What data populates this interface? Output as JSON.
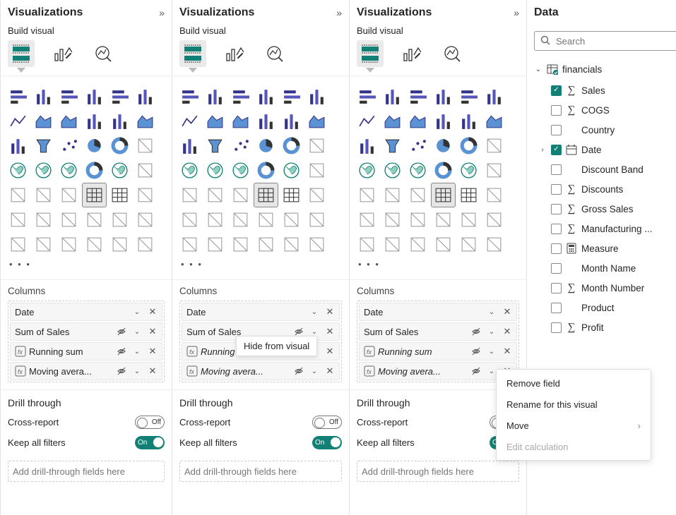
{
  "pane": {
    "vis_title": "Visualizations",
    "build_label": "Build visual",
    "data_title": "Data"
  },
  "gallery_icons": [
    "stacked-bar",
    "stacked-column",
    "clustered-bar",
    "clustered-column",
    "stacked-bar-100",
    "stacked-column-100",
    "line",
    "area",
    "stacked-area",
    "line-clustered",
    "line-stacked",
    "ribbon",
    "waterfall",
    "funnel",
    "scatter",
    "pie",
    "donut",
    "treemap",
    "map",
    "filled-map",
    "shape-map",
    "gauge",
    "arcgis",
    "card",
    "multi-row-card",
    "kpi",
    "slicer",
    "table",
    "matrix",
    "r",
    "python",
    "key-influencers",
    "decomposition",
    "qa",
    "paginated",
    "goals",
    "smart-narrative",
    "metrics",
    "power-automate",
    "power-apps",
    "decomp2",
    "more-visuals"
  ],
  "columns": {
    "label": "Columns",
    "fields": [
      {
        "name": "Date",
        "type": "plain"
      },
      {
        "name": "Sum of Sales",
        "type": "agg"
      },
      {
        "name": "Running sum",
        "type": "calc",
        "truncated": false
      },
      {
        "name": "Moving avera...",
        "type": "calc",
        "truncated": true
      }
    ]
  },
  "drill": {
    "title": "Drill through",
    "cross_label": "Cross-report",
    "cross_state": "Off",
    "keep_label": "Keep all filters",
    "keep_state": "On",
    "drop_hint": "Add drill-through fields here"
  },
  "tooltip": {
    "hide_visual": "Hide from visual"
  },
  "ctx": {
    "remove": "Remove field",
    "rename": "Rename for this visual",
    "move": "Move",
    "edit": "Edit calculation"
  },
  "search": {
    "placeholder": "Search"
  },
  "data_tree": {
    "table": "financials",
    "fields": [
      {
        "name": "Sales",
        "sigma": true,
        "checked": true,
        "caret": ""
      },
      {
        "name": "COGS",
        "sigma": true,
        "checked": false,
        "caret": ""
      },
      {
        "name": "Country",
        "sigma": false,
        "checked": false,
        "caret": ""
      },
      {
        "name": "Date",
        "sigma": false,
        "checked": true,
        "caret": "›",
        "calendar": true
      },
      {
        "name": "Discount Band",
        "sigma": false,
        "checked": false,
        "caret": ""
      },
      {
        "name": "Discounts",
        "sigma": true,
        "checked": false,
        "caret": ""
      },
      {
        "name": "Gross Sales",
        "sigma": true,
        "checked": false,
        "caret": ""
      },
      {
        "name": "Manufacturing ...",
        "sigma": true,
        "checked": false,
        "caret": ""
      },
      {
        "name": "Measure",
        "sigma": false,
        "checked": false,
        "caret": "",
        "calc_icon": true
      },
      {
        "name": "Month Name",
        "sigma": false,
        "checked": false,
        "caret": ""
      },
      {
        "name": "Month Number",
        "sigma": true,
        "checked": false,
        "caret": ""
      },
      {
        "name": "Product",
        "sigma": false,
        "checked": false,
        "caret": ""
      },
      {
        "name": "Profit",
        "sigma": true,
        "checked": false,
        "caret": ""
      }
    ]
  }
}
